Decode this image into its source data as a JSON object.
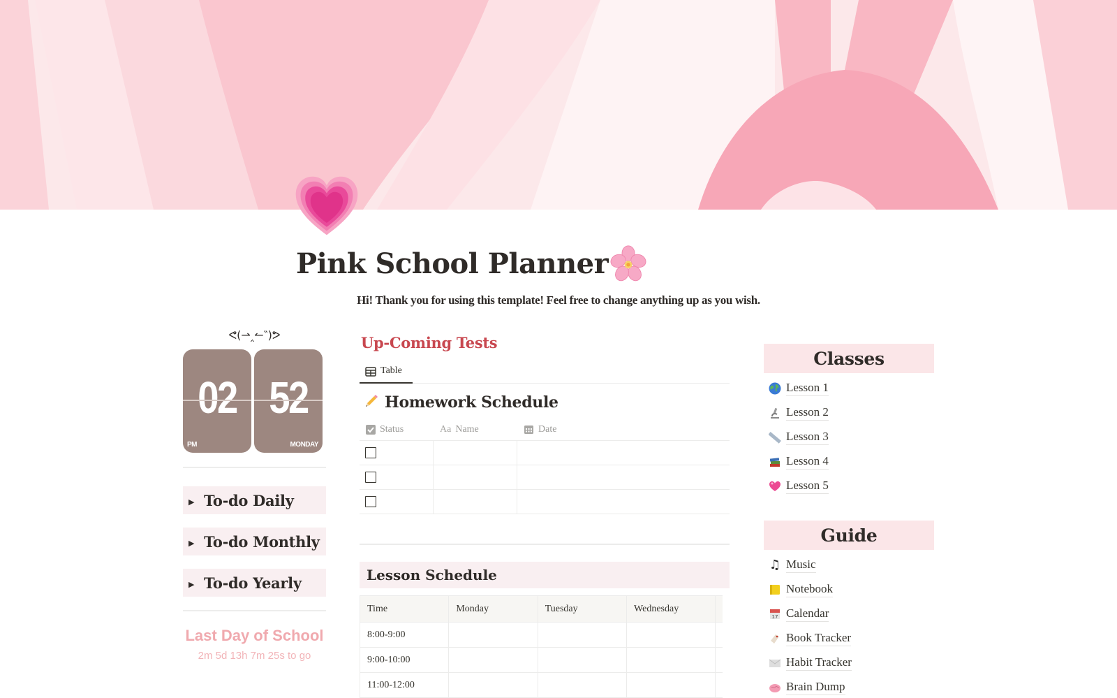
{
  "page": {
    "title": "Pink School Planner",
    "icon": "growing-heart-icon",
    "title_suffix_icon": "cherry-blossom-icon",
    "intro": "Hi! Thank you for using this template! Feel free to change anything up as you wish."
  },
  "left": {
    "kaomoji": "ᕙ(⇀‸↼‶)ᕗ",
    "clock": {
      "hour": "02",
      "minute": "52",
      "meridiem": "PM",
      "weekday": "MONDAY"
    },
    "toggles": [
      {
        "label": "To-do Daily"
      },
      {
        "label": "To-do Monthly"
      },
      {
        "label": "To-do Yearly"
      }
    ],
    "countdown": {
      "title": "Last Day of School",
      "remaining": "2m 5d 13h 7m 25s to go"
    }
  },
  "tests": {
    "heading": "Up-Coming Tests",
    "view_tab": "Table",
    "database_title": "Homework Schedule",
    "database_icon": "pencil-icon",
    "columns": [
      {
        "label": "Status",
        "icon": "checkbox-icon"
      },
      {
        "label": "Name",
        "icon": "text-aa-icon"
      },
      {
        "label": "Date",
        "icon": "calendar-icon"
      }
    ],
    "rows": [
      {
        "status": false,
        "name": "",
        "date": ""
      },
      {
        "status": false,
        "name": "",
        "date": ""
      },
      {
        "status": false,
        "name": "",
        "date": ""
      }
    ]
  },
  "lessons": {
    "heading": "Lesson Schedule",
    "columns": [
      "Time",
      "Monday",
      "Tuesday",
      "Wednesday"
    ],
    "rows": [
      [
        "8:00-9:00",
        "",
        "",
        ""
      ],
      [
        "9:00-10:00",
        "",
        "",
        ""
      ],
      [
        "11:00-12:00",
        "",
        "",
        ""
      ]
    ]
  },
  "classes": {
    "heading": "Classes",
    "items": [
      {
        "label": "Lesson 1",
        "icon": "globe-icon"
      },
      {
        "label": "Lesson 2",
        "icon": "microscope-icon"
      },
      {
        "label": "Lesson 3",
        "icon": "ruler-icon"
      },
      {
        "label": "Lesson 4",
        "icon": "books-icon"
      },
      {
        "label": "Lesson 5",
        "icon": "heart-icon"
      }
    ]
  },
  "guide": {
    "heading": "Guide",
    "items": [
      {
        "label": "Music",
        "icon": "music-note-icon"
      },
      {
        "label": "Notebook",
        "icon": "notebook-icon"
      },
      {
        "label": "Calendar",
        "icon": "calendar-icon"
      },
      {
        "label": "Book Tracker",
        "icon": "tag-icon"
      },
      {
        "label": "Habit Tracker",
        "icon": "envelope-icon"
      },
      {
        "label": "Brain Dump",
        "icon": "brain-icon"
      }
    ]
  },
  "colors": {
    "accent_red": "#c8474f",
    "toggle_bg": "#f9eff1",
    "section_bg": "#fbe6e8",
    "clock_bg": "#9d8780",
    "countdown": "#f0a9ae"
  }
}
